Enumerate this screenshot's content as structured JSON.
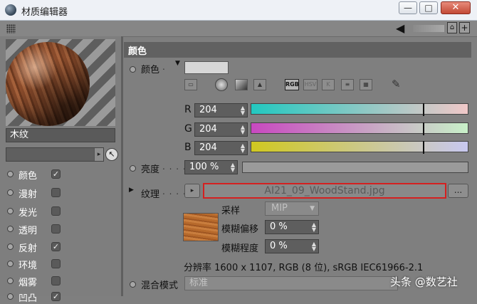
{
  "window": {
    "title": "材质编辑器",
    "minimize": "—",
    "maximize": "□",
    "close": "✕"
  },
  "toolbar": {
    "arrow_glyph": "◀",
    "lock_glyph": "🔓",
    "newwin_glyph": "⊞"
  },
  "material": {
    "name": "木纹",
    "picker_glyph": "↖"
  },
  "channels": [
    {
      "label": "颜色",
      "checked": true
    },
    {
      "label": "漫射",
      "checked": false
    },
    {
      "label": "发光",
      "checked": false
    },
    {
      "label": "透明",
      "checked": false
    },
    {
      "label": "反射",
      "checked": true
    },
    {
      "label": "环境",
      "checked": false
    },
    {
      "label": "烟雾",
      "checked": false
    },
    {
      "label": "凹凸",
      "checked": true
    }
  ],
  "color_section": {
    "header": "颜色",
    "color_label": "颜色",
    "color_dots": ".",
    "mode_icons": [
      "RGB",
      "HSV",
      "K"
    ],
    "r_label": "R",
    "r_value": "204",
    "g_label": "G",
    "g_value": "204",
    "b_label": "B",
    "b_value": "204",
    "brightness_label": "亮度",
    "brightness_dots": ". . . . .",
    "brightness_value": "100 %",
    "texture_label": "纹理",
    "texture_dots": ". . . . .",
    "texture_file": "AI21_09_WoodStand.jpg",
    "more_button": "...",
    "sampling_label": "采样",
    "sampling_value": "MIP",
    "blur_offset_label": "模糊偏移",
    "blur_offset_value": "0 %",
    "blur_scale_label": "模糊程度",
    "blur_scale_value": "0 %",
    "resolution_info": "分辨率 1600 x 1107, RGB (8 位), sRGB IEC61966-2.1",
    "blend_label": "混合模式",
    "blend_value": "标准"
  },
  "colors": {
    "accent_border": "#d42020",
    "rgb_value": "#cccccc"
  },
  "watermark": "头条 @数艺社"
}
